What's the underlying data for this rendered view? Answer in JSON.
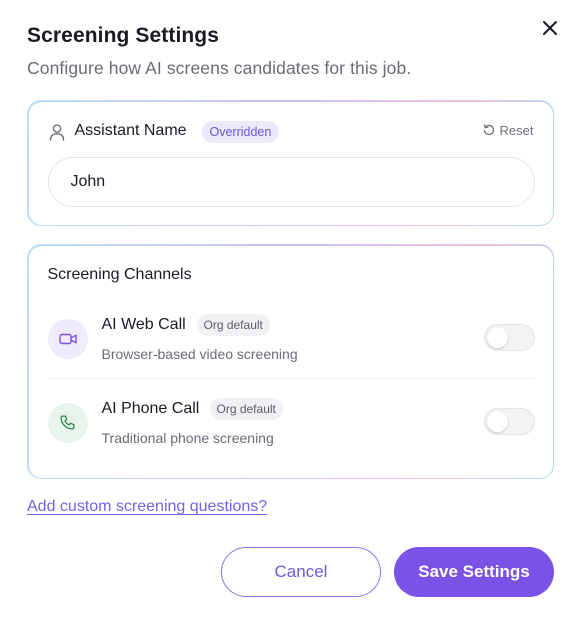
{
  "dialog": {
    "title": "Screening Settings",
    "subtitle": "Configure how AI screens candidates for this job.",
    "close_icon": "close-icon"
  },
  "assistant": {
    "label": "Assistant Name",
    "badge": "Overridden",
    "reset_label": "Reset",
    "input_value": "John",
    "icon": "person-icon"
  },
  "channels": {
    "title": "Screening Channels",
    "items": [
      {
        "name": "AI Web Call",
        "badge": "Org default",
        "description": "Browser-based video screening",
        "icon": "video-camera-icon",
        "enabled": false
      },
      {
        "name": "AI Phone Call",
        "badge": "Org default",
        "description": "Traditional phone screening",
        "icon": "phone-icon",
        "enabled": false
      }
    ]
  },
  "custom_questions_link": "Add custom screening questions?",
  "footer": {
    "cancel_label": "Cancel",
    "save_label": "Save Settings"
  },
  "colors": {
    "accent": "#7a53e6",
    "badge_bg": "#ece9fc",
    "web_icon_bg": "#efeafc",
    "phone_icon_bg": "#e8f5ec",
    "phone_icon": "#2f8a4a"
  }
}
